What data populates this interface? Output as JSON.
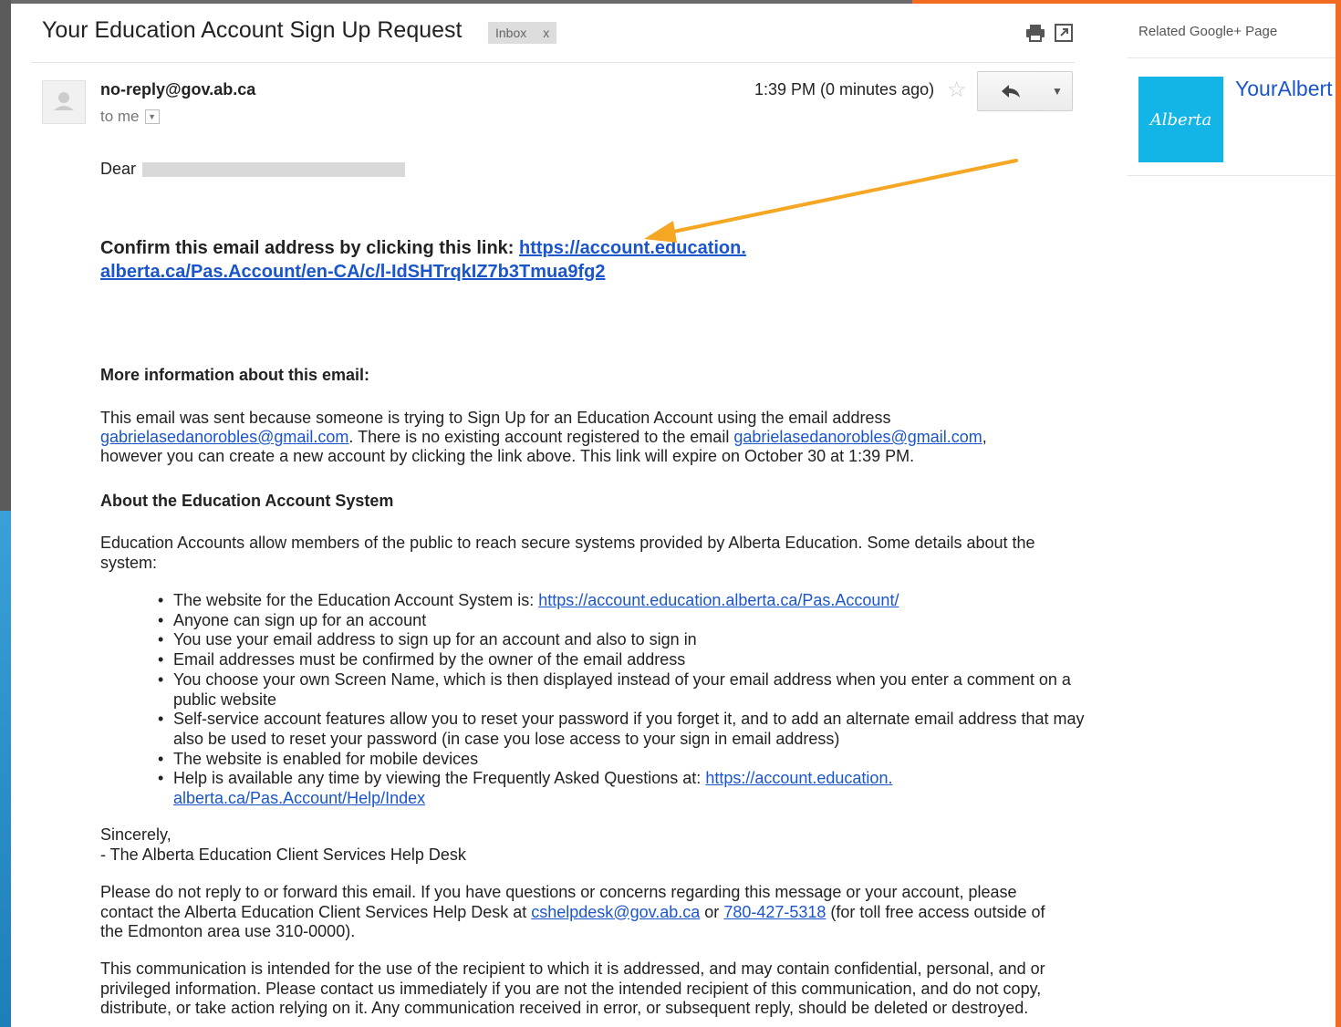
{
  "email": {
    "subject": "Your Education Account Sign Up Request",
    "label": "Inbox",
    "label_close": "x",
    "sender": "no-reply@gov.ab.ca",
    "to": "to me",
    "time": "1:39 PM (0 minutes ago)",
    "dear": "Dear",
    "confirm_text": "Confirm this email address by clicking this link: ",
    "confirm_link_1": "https://account.education.",
    "confirm_link_2": "alberta.ca/Pas.Account/en-CA/c/l-IdSHTrqkIZ7b3Tmua9fg2",
    "more_info_heading": "More information about this email:",
    "para1_a": "This email was sent because someone is trying to Sign Up for an Education Account using the email address",
    "para1_email": "gabrielasedanorobles@gmail.com",
    "para1_b": ". There is no existing account registered to the email ",
    "para1_c": "however you can create a new account by clicking the link above. This link will expire on October 30 at 1:39 PM.",
    "about_heading": "About the Education Account System",
    "para2": "Education Accounts allow members of the public to reach secure systems provided by Alberta Education. Some details about the system:",
    "bullet1_text": "The website for the Education Account System is: ",
    "bullet1_link": "https://account.education.alberta.ca/Pas.Account/",
    "bullet2": "Anyone can sign up for an account",
    "bullet3": "You use your email address to sign up for an account and also to sign in",
    "bullet4": "Email addresses must be confirmed by the owner of the email address",
    "bullet5": "You choose your own Screen Name, which is then displayed instead of your email address when you enter a comment on a public website",
    "bullet6": "Self-service account features allow you to reset your password if you forget it, and to add an alternate email address that may also be used to reset your password (in case you lose access to your sign in email address)",
    "bullet7": "The website is enabled for mobile devices",
    "bullet8_text": "Help is available any time by viewing the Frequently Asked Questions at: ",
    "bullet8_link_1": "https://account.education.",
    "bullet8_link_2": "alberta.ca/Pas.Account/Help/Index",
    "sincerely": "Sincerely,",
    "signature": "- The Alberta Education Client Services Help Desk",
    "para3_a": "Please do not reply to or forward this email. If you have questions or concerns regarding this message or your account, please contact the Alberta Education Client Services Help Desk at ",
    "para3_email": "cshelpdesk@gov.ab.ca",
    "para3_or": " or ",
    "para3_phone": "780-427-5318",
    "para3_b": " (for toll free access outside of the Edmonton area use 310-0000).",
    "para4": "This communication is intended for the use of the recipient to which it is addressed, and may contain confidential, personal, and or privileged information. Please contact us immediately if you are not the intended recipient of this communication, and do not copy, distribute, or take action relying on it. Any communication received in error, or subsequent reply, should be deleted or destroyed."
  },
  "side_panel": {
    "heading": "Related Google+ Page",
    "logo_text": "Alberta",
    "page_name": "YourAlbert"
  },
  "colors": {
    "link": "#1a55cc",
    "arrow": "#f5a623",
    "logo_bg": "#12b5e5"
  },
  "icons": [
    "print-icon",
    "new-window-icon",
    "person-icon",
    "star-icon",
    "reply-icon",
    "chevron-down-icon"
  ]
}
